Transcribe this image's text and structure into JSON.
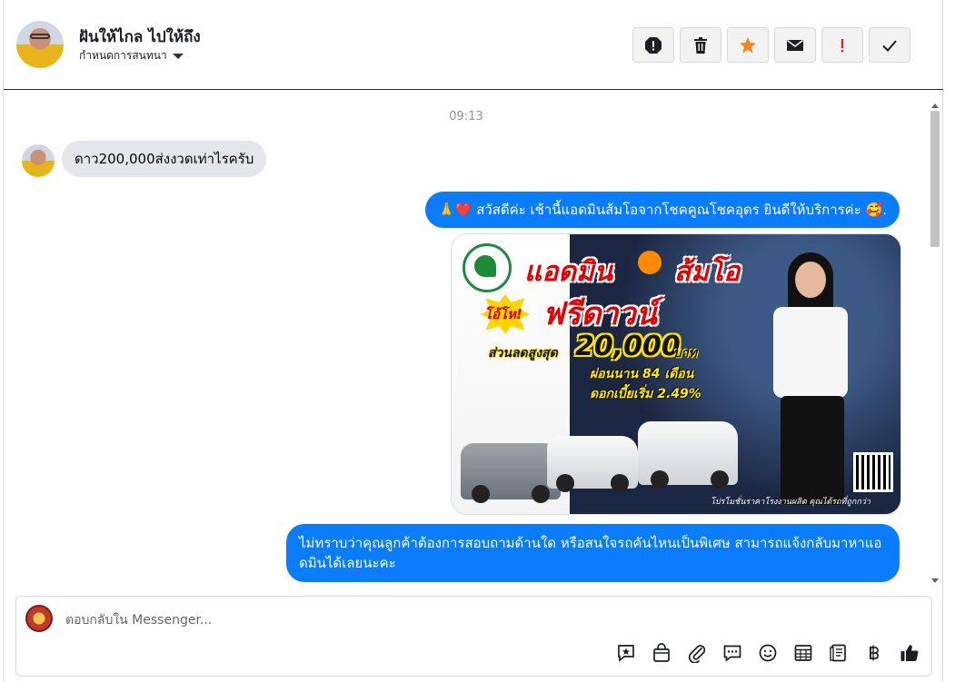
{
  "header": {
    "contact_name": "ฝันให้ไกล ไปให้ถึง",
    "assign_label": "กำหนดการสนทนา"
  },
  "actions": [
    {
      "name": "report-spam-icon",
      "color": "#1c1e21"
    },
    {
      "name": "trash-icon",
      "color": "#1c1e21"
    },
    {
      "name": "star-icon",
      "color": "#f5821f"
    },
    {
      "name": "envelope-icon",
      "color": "#1c1e21"
    },
    {
      "name": "exclamation-icon",
      "color": "#e02424"
    },
    {
      "name": "check-icon",
      "color": "#1c1e21"
    }
  ],
  "thread": {
    "timestamp": "09:13",
    "incoming": "ดาว200,000ส่งงวดเท่าไรครับ",
    "outgoing_greeting": "🙏❤️ สวัสดีค่ะ เช้านี้แอดมินส้มโอจากโชคคูณโชคอุดร ยินดีให้บริการค่ะ 🥰.",
    "outgoing_question": "ไม่ทราบว่าคุณลูกค้าต้องการสอบถามด้านใด หรือสนใจรถคันไหนเป็นพิเศษ สามารถแจ้งกลับมาหาแอดมินได้เลยนะคะ"
  },
  "promo": {
    "title": "แอดมิน",
    "brand": "ส้มโอ",
    "giveaway": "โอ้โห!",
    "free_down": "ฟรีดาวน์",
    "discount_label": "ส่วนลดสูงสุด",
    "discount_value": "20,000",
    "baht": "บาท",
    "installment": "ผ่อนนาน 84 เดือน",
    "interest": "ดอกเบี้ยเริ่ม 2.49%",
    "footer": "โปรโมชั่นราคาโรงงานผลิต คุณได้รถที่ถูกกว่า"
  },
  "composer": {
    "placeholder": "ตอบกลับใน Messenger..."
  },
  "toolbar": [
    "saved-reply-icon",
    "shop-bag-icon",
    "attachment-icon",
    "chat-bubble-icon",
    "emoji-icon",
    "calendar-grid-icon",
    "notes-icon",
    "baht-icon",
    "thumbs-up-icon"
  ],
  "colors": {
    "accent": "#0a7cff",
    "incoming_bubble": "#e4e6eb"
  }
}
